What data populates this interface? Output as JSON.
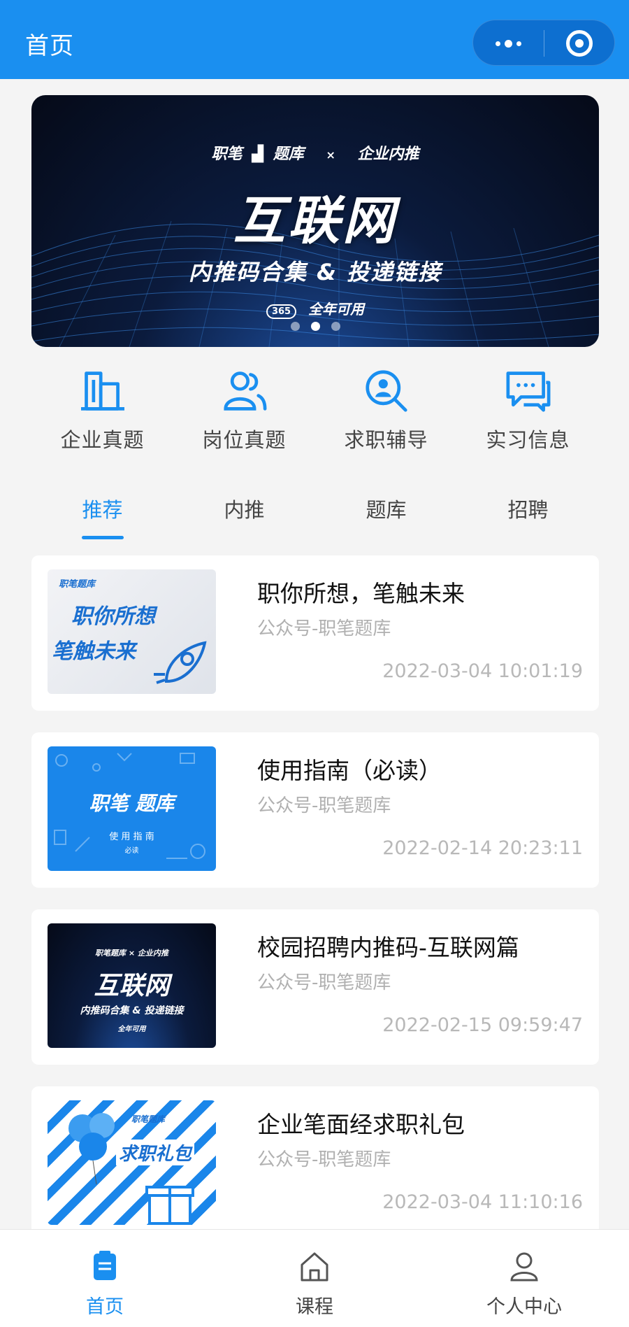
{
  "header": {
    "title": "首页"
  },
  "banner": {
    "brand_left": "职笔",
    "brand_right": "题库",
    "brand_x": "×",
    "partner": "企业内推",
    "title": "互联网",
    "subtitle": "内推码合集 & 投递链接",
    "badge": "365",
    "foot": "全年可用",
    "active_dot": 1
  },
  "quick_nav": [
    {
      "label": "企业真题",
      "icon": "building-icon"
    },
    {
      "label": "岗位真题",
      "icon": "users-icon"
    },
    {
      "label": "求职辅导",
      "icon": "search-person-icon"
    },
    {
      "label": "实习信息",
      "icon": "chat-icon"
    }
  ],
  "tabs": [
    {
      "label": "推荐",
      "active": true
    },
    {
      "label": "内推",
      "active": false
    },
    {
      "label": "题库",
      "active": false
    },
    {
      "label": "招聘",
      "active": false
    }
  ],
  "articles": [
    {
      "title": "职你所想，笔触未来",
      "source": "公众号-职笔题库",
      "time": "2022-03-04 10:01:19",
      "thumb": {
        "brand": "职笔题库",
        "line1": "职你所想",
        "line2": "笔触未来"
      }
    },
    {
      "title": "使用指南（必读）",
      "source": "公众号-职笔题库",
      "time": "2022-02-14 20:23:11",
      "thumb": {
        "brand": "职笔  题库",
        "line1": "使 用 指 南",
        "line2": "必读"
      }
    },
    {
      "title": "校园招聘内推码-互联网篇",
      "source": "公众号-职笔题库",
      "time": "2022-02-15 09:59:47",
      "thumb": {
        "brand": "职笔题库 × 企业内推",
        "line1": "互联网",
        "line2": "内推码合集 & 投递链接",
        "line3": "全年可用"
      }
    },
    {
      "title": "企业笔面经求职礼包",
      "source": "公众号-职笔题库",
      "time": "2022-03-04 11:10:16",
      "thumb": {
        "brand": "职笔题库",
        "line1": "求职礼包"
      }
    }
  ],
  "bottom_nav": [
    {
      "label": "首页",
      "active": true,
      "icon": "clipboard-icon"
    },
    {
      "label": "课程",
      "active": false,
      "icon": "home-icon"
    },
    {
      "label": "个人中心",
      "active": false,
      "icon": "user-icon"
    }
  ],
  "colors": {
    "primary": "#1a8ff0",
    "header_bg": "#1a8ff0",
    "page_bg": "#f4f4f4"
  }
}
